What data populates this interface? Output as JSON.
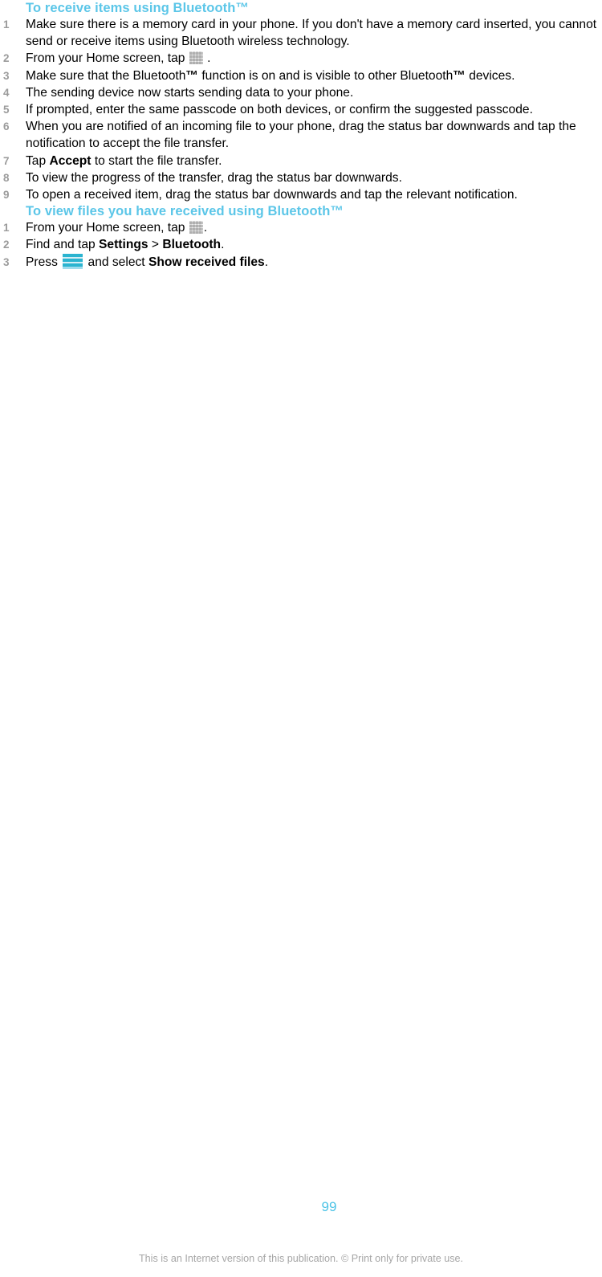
{
  "document": {
    "page_number": "99",
    "footer_note": "This is an Internet version of this publication. © Print only for private use.",
    "heading_color": "#5bc6e8",
    "number_color": "#9b9b9b",
    "footer_color": "#a6a6a6"
  },
  "sections": [
    {
      "heading": "To receive items using Bluetooth™",
      "steps": [
        {
          "number": "1",
          "parts": [
            {
              "type": "text",
              "value": "Make sure there is a memory card in your phone. If you don't have a memory card inserted, you cannot send or receive items using Bluetooth wireless technology."
            }
          ]
        },
        {
          "number": "2",
          "parts": [
            {
              "type": "text",
              "value": "From your Home screen, tap "
            },
            {
              "type": "icon",
              "value": "app-grid-icon"
            },
            {
              "type": "text",
              "value": " ."
            }
          ]
        },
        {
          "number": "3",
          "parts": [
            {
              "type": "text",
              "value": "Make sure that the Bluetooth"
            },
            {
              "type": "bold",
              "value": "™"
            },
            {
              "type": "text",
              "value": " function is on and is visible to other Bluetooth"
            },
            {
              "type": "bold",
              "value": "™"
            },
            {
              "type": "text",
              "value": " devices."
            }
          ]
        },
        {
          "number": "4",
          "parts": [
            {
              "type": "text",
              "value": "The sending device now starts sending data to your phone."
            }
          ]
        },
        {
          "number": "5",
          "parts": [
            {
              "type": "text",
              "value": "If prompted, enter the same passcode on both devices, or confirm the suggested passcode."
            }
          ]
        },
        {
          "number": "6",
          "parts": [
            {
              "type": "text",
              "value": "When you are notified of an incoming file to your phone, drag the status bar downwards and tap the notification to accept the file transfer."
            }
          ]
        },
        {
          "number": "7",
          "parts": [
            {
              "type": "text",
              "value": "Tap "
            },
            {
              "type": "bold",
              "value": "Accept"
            },
            {
              "type": "text",
              "value": " to start the file transfer."
            }
          ]
        },
        {
          "number": "8",
          "parts": [
            {
              "type": "text",
              "value": "To view the progress of the transfer, drag the status bar downwards."
            }
          ]
        },
        {
          "number": "9",
          "parts": [
            {
              "type": "text",
              "value": "To open a received item, drag the status bar downwards and tap the relevant notification."
            }
          ]
        }
      ]
    },
    {
      "heading": "To view files you have received using Bluetooth™",
      "steps": [
        {
          "number": "1",
          "parts": [
            {
              "type": "text",
              "value": "From your Home screen, tap "
            },
            {
              "type": "icon",
              "value": "app-grid-icon"
            },
            {
              "type": "text",
              "value": "."
            }
          ]
        },
        {
          "number": "2",
          "parts": [
            {
              "type": "text",
              "value": "Find and tap "
            },
            {
              "type": "bold",
              "value": "Settings"
            },
            {
              "type": "text",
              "value": " > "
            },
            {
              "type": "bold",
              "value": "Bluetooth"
            },
            {
              "type": "text",
              "value": "."
            }
          ]
        },
        {
          "number": "3",
          "parts": [
            {
              "type": "text",
              "value": "Press "
            },
            {
              "type": "icon",
              "value": "menu-icon"
            },
            {
              "type": "text",
              "value": " and select "
            },
            {
              "type": "bold",
              "value": "Show received files"
            },
            {
              "type": "text",
              "value": "."
            }
          ]
        }
      ]
    }
  ]
}
